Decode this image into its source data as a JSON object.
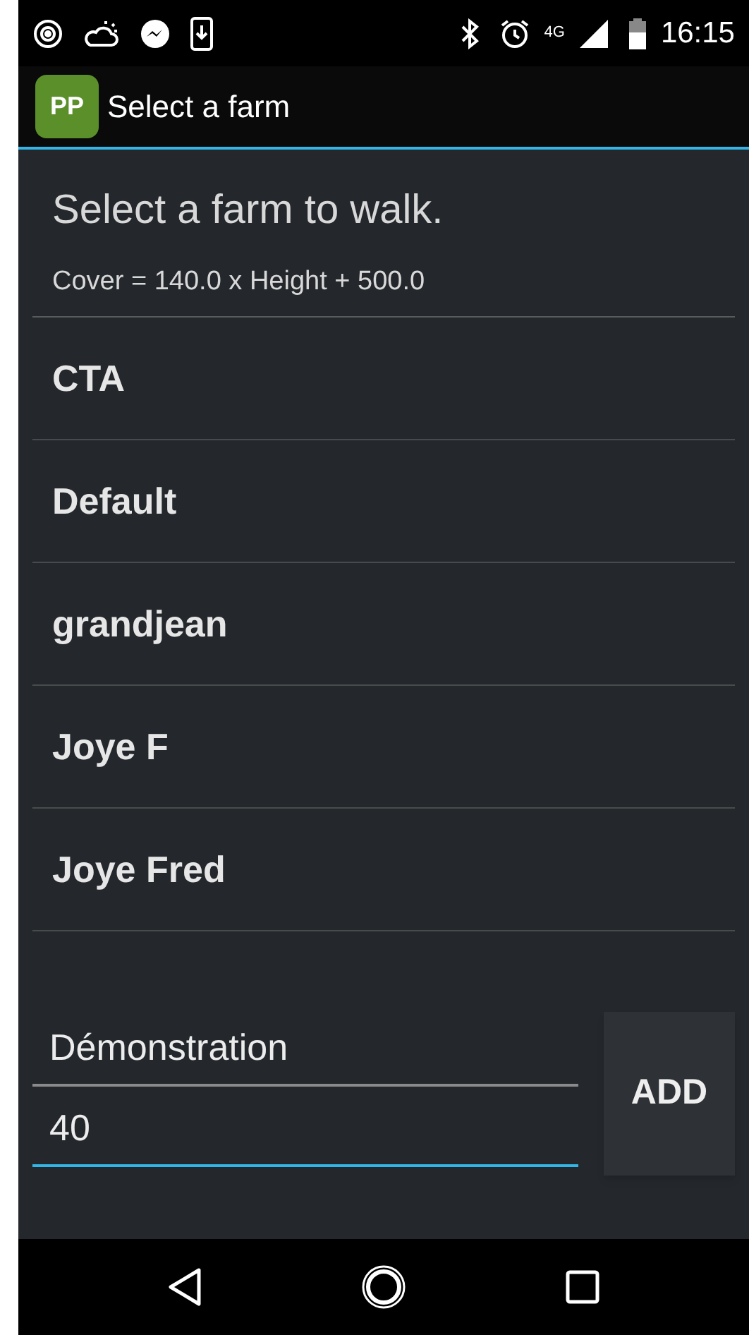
{
  "status_bar": {
    "time": "16:15",
    "network": "4G"
  },
  "app_bar": {
    "logo": "PP",
    "title": "Select a farm"
  },
  "heading": "Select a farm to walk.",
  "formula": "Cover = 140.0 x Height + 500.0",
  "farms": [
    {
      "name": "CTA"
    },
    {
      "name": "Default"
    },
    {
      "name": "grandjean"
    },
    {
      "name": "Joye F"
    },
    {
      "name": "Joye Fred"
    }
  ],
  "fields": [
    {
      "value": "Démonstration",
      "focused": false
    },
    {
      "value": "40",
      "focused": true
    }
  ],
  "add_button": "ADD"
}
